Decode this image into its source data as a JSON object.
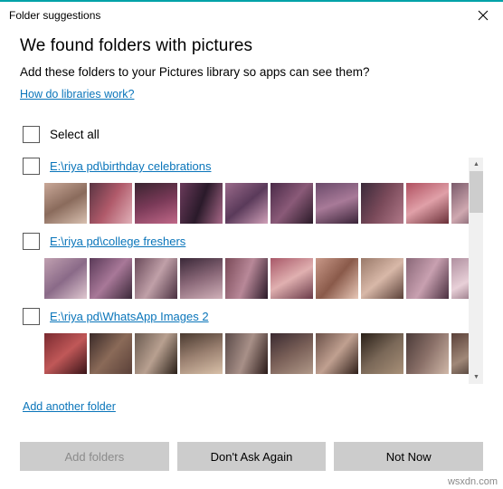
{
  "window": {
    "title": "Folder suggestions",
    "close_icon": "close-icon",
    "accent_color": "#00a2a8"
  },
  "main": {
    "heading": "We found folders with pictures",
    "subheading": "Add these folders to your Pictures library so apps can see them?",
    "help_link": "How do libraries work?",
    "select_all_label": "Select all",
    "add_another_label": "Add another folder",
    "link_color": "#0a75ba"
  },
  "folders": [
    {
      "path": "E:\\riya pd\\birthday celebrations",
      "checked": false,
      "thumbs": [
        "linear-gradient(150deg,#c9a898,#8a6b5c,#d8c0b0)",
        "linear-gradient(120deg,#5a3442,#b05a6a,#e0b0b8)",
        "linear-gradient(160deg,#3a2430,#7a3a58,#c06888)",
        "linear-gradient(110deg,#6a3a5a,#2a1a2a,#a86888)",
        "linear-gradient(140deg,#9a6a8a,#5a3a5a,#d0a0b8)",
        "linear-gradient(130deg,#4a2a48,#8a5a78,#2a1a28)",
        "linear-gradient(160deg,#6a4a6a,#a87a98,#3a2438)",
        "linear-gradient(120deg,#3a2a3a,#7a4a5a,#b07888)",
        "linear-gradient(150deg,#b05060,#e0a0a8,#6a3038)",
        "linear-gradient(140deg,#7a5a6a,#cfa8b0,#4a3040)"
      ]
    },
    {
      "path": "E:\\riya pd\\college freshers",
      "checked": false,
      "thumbs": [
        "linear-gradient(140deg,#c0a0b0,#8a6a88,#e0c8d0)",
        "linear-gradient(130deg,#5a3a58,#a87898,#3a2838)",
        "linear-gradient(120deg,#6a4a5a,#c0a0a8,#4a3040)",
        "linear-gradient(160deg,#3a2838,#8a6878,#d0b0b8)",
        "linear-gradient(110deg,#7a4a58,#b88898,#2a1a28)",
        "linear-gradient(150deg,#a85868,#e0b0b0,#6a3a48)",
        "linear-gradient(130deg,#c89888,#8a5a4a,#e8c8b8)",
        "linear-gradient(140deg,#9a7a6a,#d8b8a8,#5a4038)",
        "linear-gradient(120deg,#8a6878,#c8a0b0,#4a3040)",
        "linear-gradient(150deg,#b090a0,#e8d0d8,#6a4858)"
      ]
    },
    {
      "path": "E:\\riya pd\\WhatsApp Images 2",
      "checked": false,
      "thumbs": [
        "linear-gradient(140deg,#7a2a30,#c05858,#3a1418)",
        "linear-gradient(130deg,#3a2a28,#8a6a58,#5a4038)",
        "linear-gradient(120deg,#6a5a50,#b8a090,#2a2018)",
        "linear-gradient(160deg,#4a3a30,#9a8070,#d8c0a8)",
        "linear-gradient(110deg,#5a4a48,#a89088,#2a1a18)",
        "linear-gradient(150deg,#3a2a30,#7a6058,#b09888)",
        "linear-gradient(130deg,#6a5048,#c0a090,#30201a)",
        "linear-gradient(140deg,#2a2018,#7a6858,#a89078)",
        "linear-gradient(120deg,#4a3a38,#8a7068,#d0b8a8)",
        "linear-gradient(150deg,#5a4038,#a08878,#281c18)"
      ]
    }
  ],
  "scrollbar": {
    "up_arrow": "▲",
    "down_arrow": "▼"
  },
  "footer": {
    "buttons": [
      {
        "label": "Add folders",
        "disabled": true
      },
      {
        "label": "Don't Ask Again",
        "disabled": false
      },
      {
        "label": "Not Now",
        "disabled": false
      }
    ]
  },
  "watermark": "wsxdn.com"
}
